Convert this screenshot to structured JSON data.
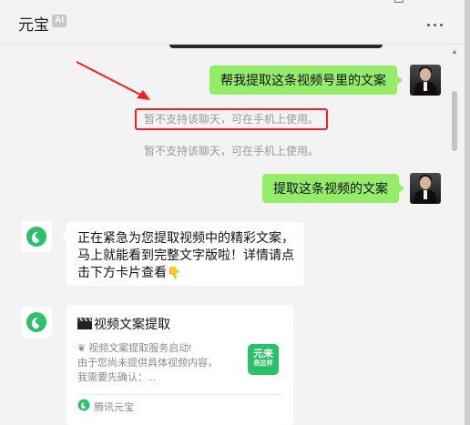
{
  "header": {
    "title": "元宝",
    "ai_badge": "AI",
    "more_icon": "more-horizontal-icon"
  },
  "messages": {
    "user_msg_1": "帮我提取这条视频号里的文案",
    "system_tip_1": "暂不支持该聊天，可在手机上使用。",
    "system_tip_2": "暂不支持该聊天，可在手机上使用。",
    "user_msg_2": "提取这条视频的文案",
    "bot_msg_line1": "正在紧急为您提取视频中的精彩文案，",
    "bot_msg_line2": "马上就能看到完整文字版啦！详情请点",
    "bot_msg_line3": "击下方卡片查看",
    "bot_msg_emoji": "👇"
  },
  "card": {
    "title": "视频文案提取",
    "title_icon": "clapper-board-icon",
    "desc_line1": "❦ 视频文案提取服务启动!",
    "desc_line2": "由于您尚未提供具体视频内容，",
    "desc_line3": "我需要先确认：...",
    "thumb_line1": "元来",
    "thumb_line2": "是这样",
    "footer": "腾讯元宝"
  },
  "colors": {
    "user_bubble": "#95ec69",
    "highlight": "#ee2222",
    "brand_green": "#2cc06a",
    "window_bg": "#f3f3f3"
  }
}
